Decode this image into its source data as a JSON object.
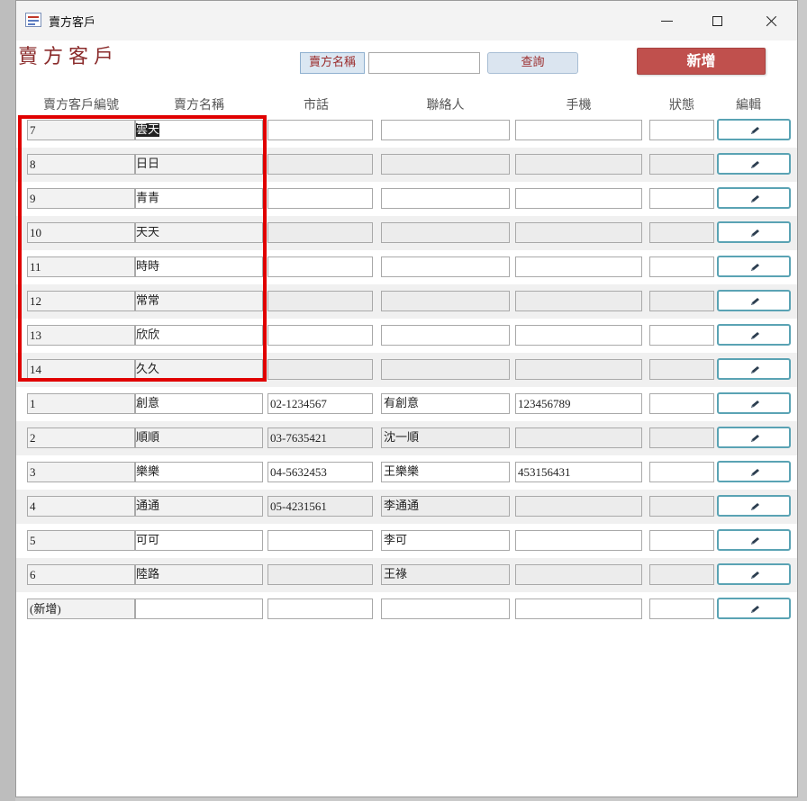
{
  "window": {
    "title": "賣方客戶"
  },
  "form": {
    "title": "賣方客戶",
    "search_label": "賣方名稱",
    "search_value": "",
    "query_button": "查詢",
    "add_button": "新增"
  },
  "columns": [
    "賣方客戶編號",
    "賣方名稱",
    "市話",
    "聯絡人",
    "手機",
    "狀態",
    "編輯"
  ],
  "rows": [
    {
      "id": "7",
      "name": "雲天",
      "phone": "",
      "contact": "",
      "mobile": "",
      "status": ""
    },
    {
      "id": "8",
      "name": "日日",
      "phone": "",
      "contact": "",
      "mobile": "",
      "status": ""
    },
    {
      "id": "9",
      "name": "青青",
      "phone": "",
      "contact": "",
      "mobile": "",
      "status": ""
    },
    {
      "id": "10",
      "name": "天天",
      "phone": "",
      "contact": "",
      "mobile": "",
      "status": ""
    },
    {
      "id": "11",
      "name": "時時",
      "phone": "",
      "contact": "",
      "mobile": "",
      "status": ""
    },
    {
      "id": "12",
      "name": "常常",
      "phone": "",
      "contact": "",
      "mobile": "",
      "status": ""
    },
    {
      "id": "13",
      "name": "欣欣",
      "phone": "",
      "contact": "",
      "mobile": "",
      "status": ""
    },
    {
      "id": "14",
      "name": "久久",
      "phone": "",
      "contact": "",
      "mobile": "",
      "status": ""
    },
    {
      "id": "1",
      "name": "創意",
      "phone": "02-1234567",
      "contact": "有創意",
      "mobile": "123456789",
      "status": ""
    },
    {
      "id": "2",
      "name": "順順",
      "phone": "03-7635421",
      "contact": "沈一順",
      "mobile": "",
      "status": ""
    },
    {
      "id": "3",
      "name": "樂樂",
      "phone": "04-5632453",
      "contact": "王樂樂",
      "mobile": "453156431",
      "status": ""
    },
    {
      "id": "4",
      "name": "通通",
      "phone": "05-4231561",
      "contact": "李通通",
      "mobile": "",
      "status": ""
    },
    {
      "id": "5",
      "name": "可可",
      "phone": "",
      "contact": "李可",
      "mobile": "",
      "status": ""
    },
    {
      "id": "6",
      "name": "陸路",
      "phone": "",
      "contact": "王祿",
      "mobile": "",
      "status": ""
    },
    {
      "id": "(新增)",
      "name": "",
      "phone": "",
      "contact": "",
      "mobile": "",
      "status": ""
    }
  ],
  "icons": {
    "edit": "pencil-icon",
    "app": "form-icon"
  },
  "colors": {
    "accent_red": "#c0504d",
    "highlight": "#e00000",
    "edit_border": "#5aa3b4"
  }
}
